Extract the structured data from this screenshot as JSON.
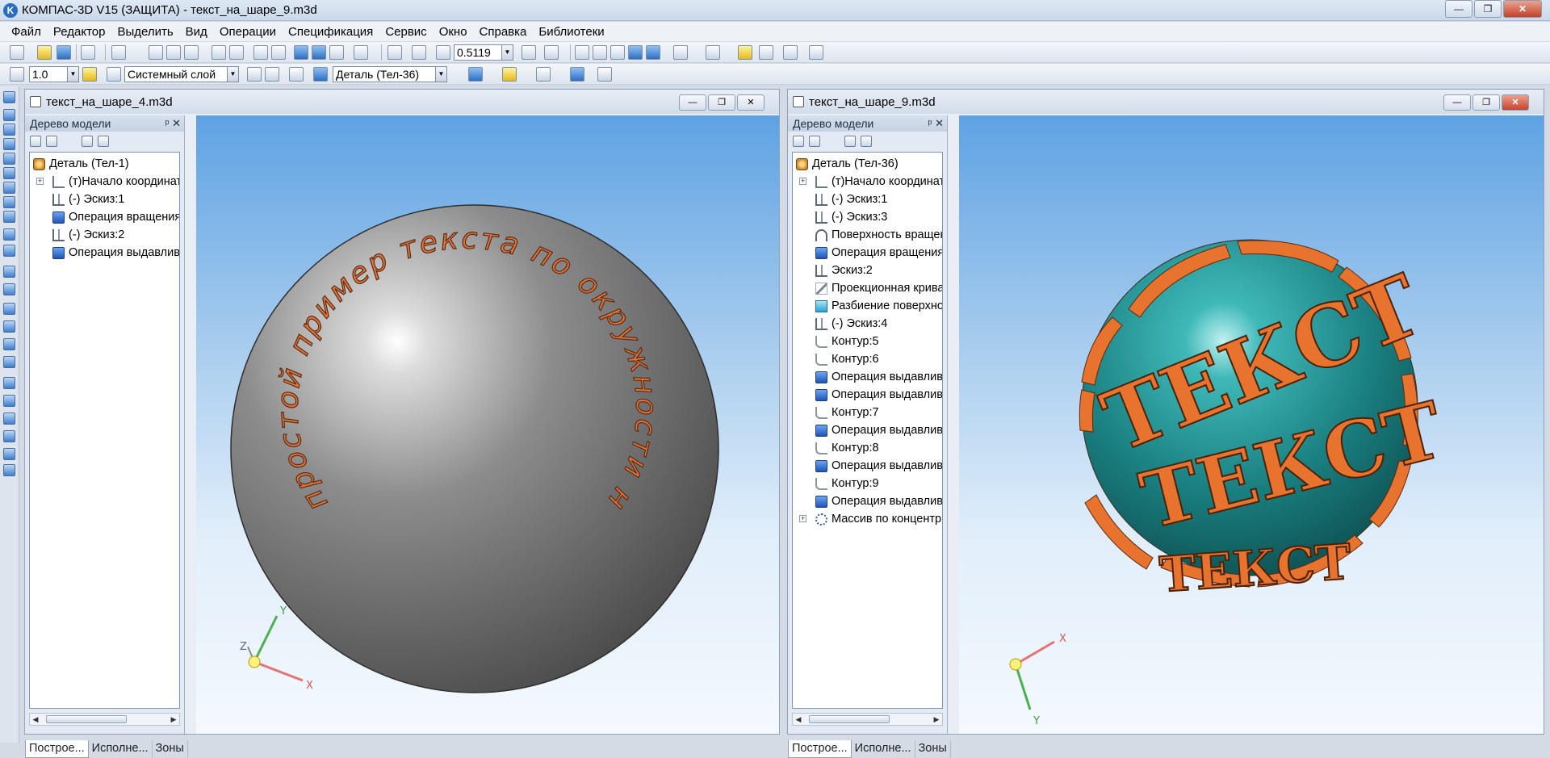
{
  "app": {
    "title": "КОМПАС-3D V15 (ЗАЩИТА) - текст_на_шаре_9.m3d",
    "logo_letter": "K",
    "win_minimize": "—",
    "win_restore": "❐",
    "win_close": "✕"
  },
  "menu": [
    "Файл",
    "Редактор",
    "Выделить",
    "Вид",
    "Операции",
    "Спецификация",
    "Сервис",
    "Окно",
    "Справка",
    "Библиотеки"
  ],
  "toolbar": {
    "zoom_value": "0.5119",
    "step_value": "1.0",
    "layer_value": "Системный слой",
    "detail_value": "Деталь (Тел-36)"
  },
  "colors": {
    "accent": "#2a6bc4",
    "sphere_gray": "#8a8a8a",
    "sphere_teal": "#1f8c8c",
    "text_orange": "#e06a2a"
  },
  "tree_common": {
    "header": "Дерево модели",
    "pin": "ᵖ",
    "close": "✕",
    "tabs": [
      "Построе...",
      "Исполне...",
      "Зоны"
    ]
  },
  "left_window": {
    "title": "текст_на_шаре_4.m3d",
    "tree": [
      {
        "label": "Деталь (Тел-1)",
        "icon": "detail-icon",
        "indent": 0
      },
      {
        "label": "(т)Начало координат",
        "icon": "origin-icon",
        "indent": 1,
        "expand": true
      },
      {
        "label": "(-) Эскиз:1",
        "icon": "sketch-icon",
        "indent": 1
      },
      {
        "label": "Операция вращения",
        "icon": "operation-icon",
        "indent": 1
      },
      {
        "label": "(-) Эскиз:2",
        "icon": "sketch-icon",
        "indent": 1
      },
      {
        "label": "Операция выдавливания",
        "icon": "operation-icon",
        "indent": 1
      }
    ],
    "circle_text": "простой пример текста по окружности на шаре",
    "axes": {
      "x": "X",
      "y": "Y",
      "z": "Z"
    }
  },
  "right_window": {
    "title": "текст_на_шаре_9.m3d",
    "tree": [
      {
        "label": "Деталь (Тел-36)",
        "icon": "detail-icon",
        "indent": 0
      },
      {
        "label": "(т)Начало координат",
        "icon": "origin-icon",
        "indent": 1,
        "expand": true
      },
      {
        "label": "(-) Эскиз:1",
        "icon": "sketch-icon",
        "indent": 1
      },
      {
        "label": "(-) Эскиз:3",
        "icon": "sketch-icon",
        "indent": 1
      },
      {
        "label": "Поверхность вращения",
        "icon": "surface-icon",
        "indent": 1
      },
      {
        "label": "Операция вращения",
        "icon": "operation-icon",
        "indent": 1
      },
      {
        "label": "Эскиз:2",
        "icon": "sketch-icon",
        "indent": 1
      },
      {
        "label": "Проекционная кривая",
        "icon": "projection-icon",
        "indent": 1
      },
      {
        "label": "Разбиение поверхности",
        "icon": "split-icon",
        "indent": 1
      },
      {
        "label": "(-) Эскиз:4",
        "icon": "sketch-icon",
        "indent": 1
      },
      {
        "label": "Контур:5",
        "icon": "contour-icon",
        "indent": 1
      },
      {
        "label": "Контур:6",
        "icon": "contour-icon",
        "indent": 1
      },
      {
        "label": "Операция выдавливания",
        "icon": "operation-icon",
        "indent": 1
      },
      {
        "label": "Операция выдавливания",
        "icon": "operation-icon",
        "indent": 1
      },
      {
        "label": "Контур:7",
        "icon": "contour-icon",
        "indent": 1
      },
      {
        "label": "Операция выдавливания",
        "icon": "operation-icon",
        "indent": 1
      },
      {
        "label": "Контур:8",
        "icon": "contour-icon",
        "indent": 1
      },
      {
        "label": "Операция выдавливания",
        "icon": "operation-icon",
        "indent": 1
      },
      {
        "label": "Контур:9",
        "icon": "contour-icon",
        "indent": 1
      },
      {
        "label": "Операция выдавливания",
        "icon": "operation-icon",
        "indent": 1
      },
      {
        "label": "Массив по концентрической сетке",
        "icon": "array-icon",
        "indent": 1,
        "expand": true
      }
    ],
    "sphere_word": "ТЕКСТ",
    "axes": {
      "x": "X",
      "y": "Y"
    }
  }
}
